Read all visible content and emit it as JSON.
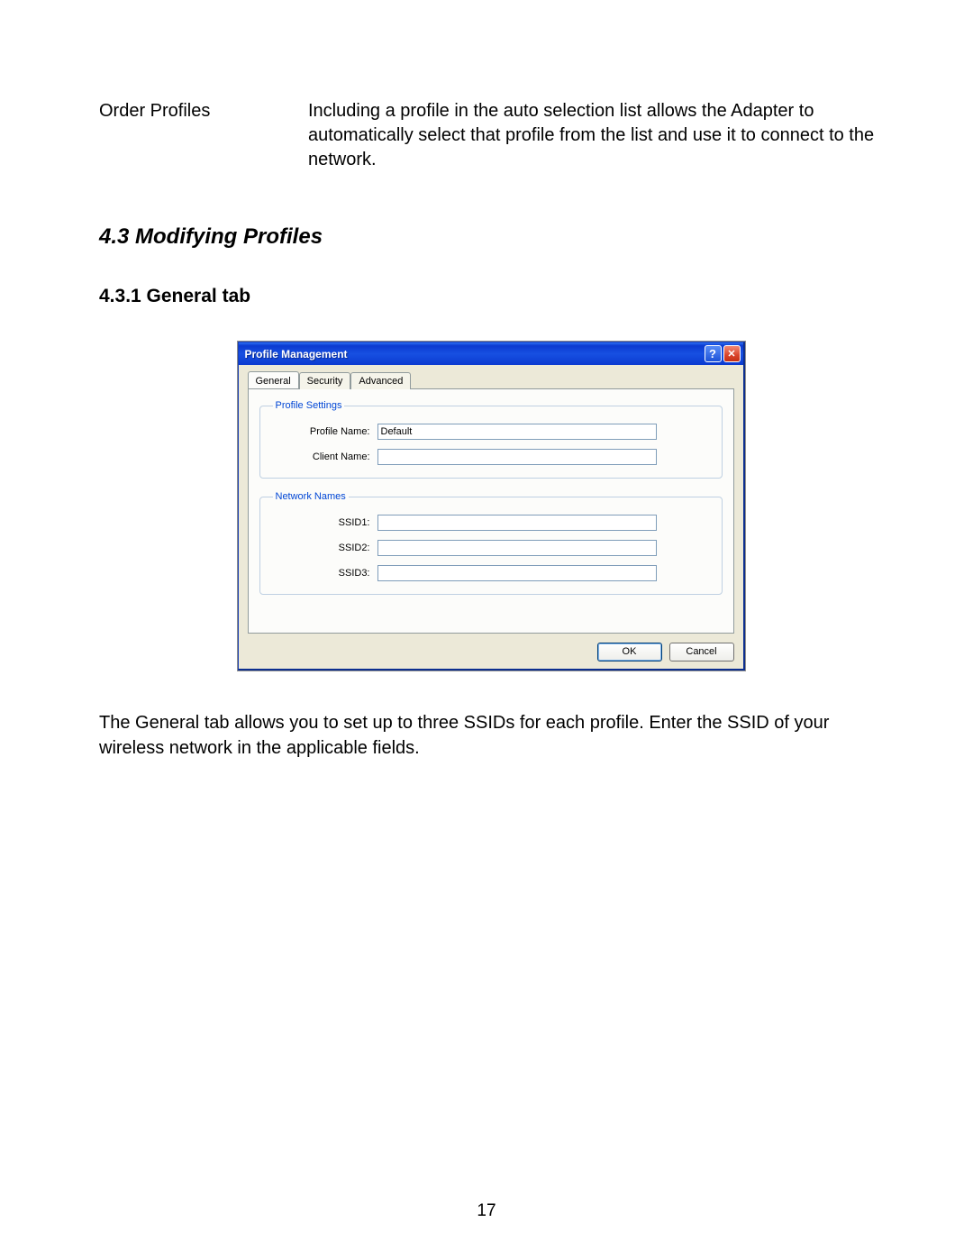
{
  "top": {
    "label": "Order Profiles",
    "desc": "Including a profile in the auto selection list allows the Adapter to automatically select that profile from the list and use it to connect to the network."
  },
  "section_heading": "4.3 Modifying Profiles",
  "subsection_heading": "4.3.1 General tab",
  "dialog": {
    "title": "Profile Management",
    "help_glyph": "?",
    "close_glyph": "✕",
    "tabs": {
      "general": "General",
      "security": "Security",
      "advanced": "Advanced"
    },
    "groups": {
      "profile_settings": {
        "legend": "Profile Settings",
        "profile_name_label": "Profile Name:",
        "profile_name_value": "Default",
        "client_name_label": "Client Name:",
        "client_name_value": ""
      },
      "network_names": {
        "legend": "Network Names",
        "ssid1_label": "SSID1:",
        "ssid1_value": "",
        "ssid2_label": "SSID2:",
        "ssid2_value": "",
        "ssid3_label": "SSID3:",
        "ssid3_value": ""
      }
    },
    "buttons": {
      "ok": "OK",
      "cancel": "Cancel"
    }
  },
  "caption": "The General tab allows you to set up to three SSIDs for each profile. Enter the SSID of your wireless network in the applicable fields.",
  "page_number": "17"
}
